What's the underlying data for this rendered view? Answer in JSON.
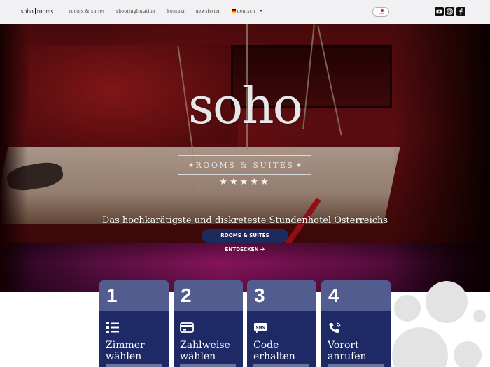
{
  "nav": {
    "logo_left": "soho",
    "logo_right": "rooms",
    "links": [
      "rooms & suites",
      "shootinglocation",
      "kontakt",
      "newsletter"
    ],
    "language": "deutsch",
    "social": [
      "youtube-icon",
      "instagram-icon",
      "facebook-icon"
    ]
  },
  "hero": {
    "brand": "soho",
    "subtitle": "ROOMS & SUITES",
    "stars": "★★★★★",
    "tagline": "Das hochkarätigste und diskreteste Stundenhotel Österreichs",
    "cta": "ROOMS & SUITES ENTDECKEN"
  },
  "steps": [
    {
      "number": "1",
      "title_line1": "Zimmer",
      "title_line2": "wählen",
      "icon": "list-icon"
    },
    {
      "number": "2",
      "title_line1": "Zahlweise",
      "title_line2": "wählen",
      "icon": "credit-card-icon"
    },
    {
      "number": "3",
      "title_line1": "Code",
      "title_line2": "erhalten",
      "icon": "sms-icon"
    },
    {
      "number": "4",
      "title_line1": "Vorort",
      "title_line2": "anrufen",
      "icon": "phone-icon"
    }
  ],
  "colors": {
    "nav_bg": "#f1f0f3",
    "card_top": "#535c8f",
    "card_body": "#1e2a66",
    "cta_bg": "#1f2a5c"
  }
}
